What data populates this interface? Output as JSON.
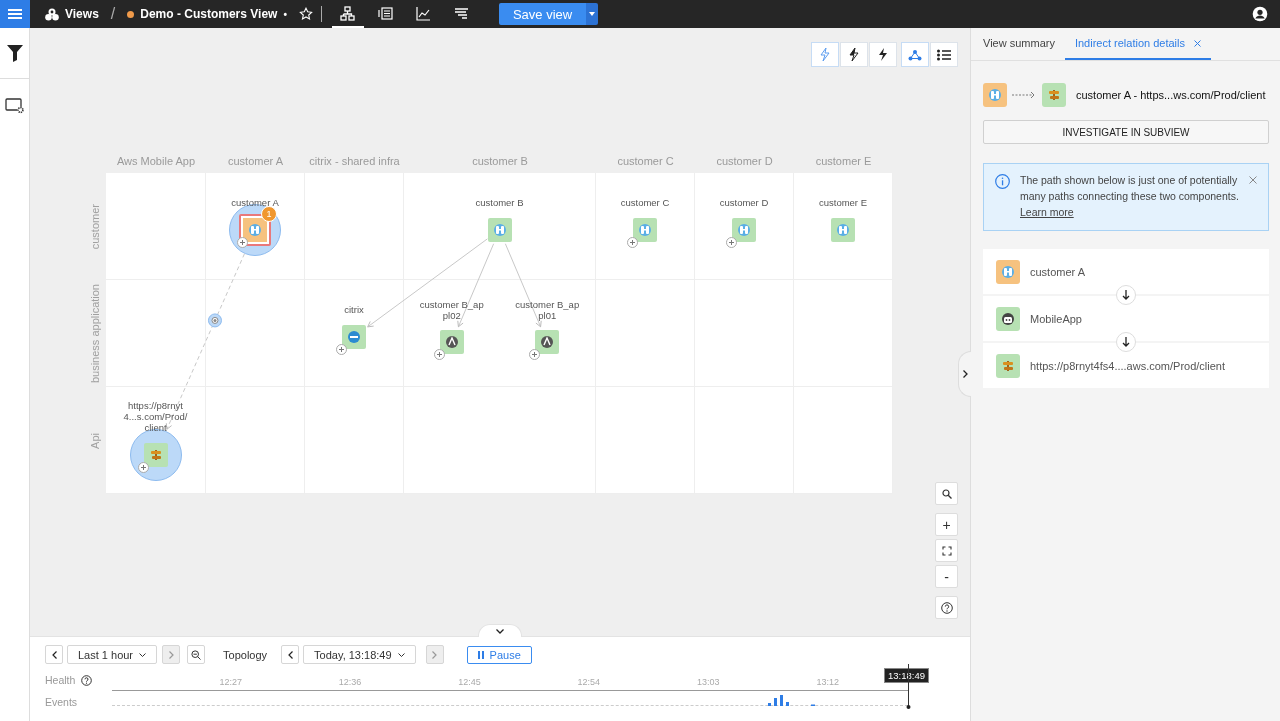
{
  "topbar": {
    "root": "Views",
    "separator": "/",
    "view_name": "Demo - Customers View",
    "unsaved_mark": "•",
    "view_modes": [
      {
        "kind": "topology",
        "selected": true
      },
      {
        "kind": "list",
        "selected": false
      },
      {
        "kind": "chart",
        "selected": false
      },
      {
        "kind": "events",
        "selected": false
      }
    ],
    "save_button": "Save view"
  },
  "canvas_toolbar": {
    "severity_filters": [
      {
        "kind": "outline",
        "selected": true
      },
      {
        "kind": "half",
        "selected": false
      },
      {
        "kind": "solid",
        "selected": false
      }
    ],
    "layouts": [
      {
        "kind": "graph",
        "selected": true
      },
      {
        "kind": "list",
        "selected": false
      }
    ]
  },
  "diagram": {
    "columns": [
      "Aws Mobile App",
      "customer A",
      "citrix - shared infra",
      "customer B",
      "customer C",
      "customer D",
      "customer E"
    ],
    "rows": [
      {
        "label": "customer",
        "cells": [
          {},
          {
            "nodes": [
              {
                "label": "customer A",
                "color": "#f6c27f",
                "kind": "customer",
                "highlighted": true,
                "selected": true,
                "badge": "1",
                "expandable": true,
                "outgoing": true
              }
            ]
          },
          {},
          {
            "nodes": [
              {
                "label": "customer B",
                "color": "#b7e1b3",
                "kind": "customer",
                "highlighted": false,
                "selected": false,
                "expandable": false,
                "outgoing": true
              }
            ]
          },
          {
            "nodes": [
              {
                "label": "customer C",
                "color": "#b7e1b3",
                "kind": "customer",
                "highlighted": false,
                "selected": false,
                "expandable": true,
                "outgoing": false
              }
            ]
          },
          {
            "nodes": [
              {
                "label": "customer D",
                "color": "#b7e1b3",
                "kind": "customer",
                "highlighted": false,
                "selected": false,
                "expandable": true,
                "outgoing": false
              }
            ]
          },
          {
            "nodes": [
              {
                "label": "customer E",
                "color": "#b7e1b3",
                "kind": "customer",
                "highlighted": false,
                "selected": false,
                "expandable": false,
                "outgoing": false
              }
            ]
          }
        ]
      },
      {
        "label": "business application",
        "cells": [
          {},
          {},
          {
            "nodes": [
              {
                "label": "citrix",
                "color": "#b7e1b3",
                "kind": "citrix",
                "highlighted": false,
                "selected": false,
                "expandable": true,
                "outgoing": false,
                "incoming": {
                  "dashed": false,
                  "midpoint": false
                }
              }
            ]
          },
          {
            "nodes": [
              {
                "label": "customer B_appl02",
                "color": "#b7e1b3",
                "kind": "app",
                "highlighted": false,
                "selected": false,
                "expandable": true,
                "outgoing": false,
                "incoming": {
                  "dashed": false,
                  "midpoint": false
                }
              },
              {
                "label": "customer B_appl01",
                "color": "#b7e1b3",
                "kind": "app",
                "highlighted": false,
                "selected": false,
                "expandable": true,
                "outgoing": false,
                "incoming": {
                  "dashed": false,
                  "midpoint": false
                }
              }
            ]
          },
          {},
          {},
          {}
        ]
      },
      {
        "label": "Api",
        "cells": [
          {
            "nodes": [
              {
                "label": "https://p8rnyt4...s.com/Prod/client",
                "color": "#b7e1b3",
                "kind": "api",
                "highlighted": true,
                "selected": false,
                "expandable": true,
                "outgoing": false,
                "incoming": {
                  "dashed": true,
                  "midpoint": true
                }
              }
            ]
          },
          {},
          {},
          {},
          {},
          {},
          {}
        ]
      }
    ]
  },
  "zoom_controls": {
    "zoom_in": "+",
    "zoom_out": "-"
  },
  "timeline": {
    "range": "Last 1 hour",
    "range_nav": [
      {
        "disabled": false
      },
      {
        "disabled": true
      }
    ],
    "mode": "Topology",
    "time": "Today, 13:18:49",
    "time_nav": [
      {
        "disabled": false
      },
      {
        "disabled": true
      }
    ],
    "pause": "Pause",
    "health_label": "Health",
    "events_label": "Events",
    "ticks": [
      "12:27",
      "12:36",
      "12:45",
      "12:54",
      "13:03",
      "13:12"
    ],
    "current_time": "13:18:49"
  },
  "right_panel": {
    "tabs": [
      {
        "label": "View summary",
        "selected": false,
        "closable": false
      },
      {
        "label": "Indirect relation details",
        "selected": true,
        "closable": true
      }
    ],
    "relation": {
      "from": {
        "kind": "customer",
        "color": "#f6c27f"
      },
      "to": {
        "kind": "api",
        "color": "#b7e1b3"
      },
      "title": "customer A - https...ws.com/Prod/client"
    },
    "investigate_button": "INVESTIGATE IN SUBVIEW",
    "info": {
      "text": "The path shown below is just one of potentially many paths connecting these two components.",
      "link": "Learn more"
    },
    "path": [
      {
        "label": "customer A",
        "kind": "customer",
        "color": "#f6c27f"
      },
      {
        "label": "MobileApp",
        "kind": "mobile",
        "color": "#b7e1b3"
      },
      {
        "label": "https://p8rnyt4fs4....aws.com/Prod/client",
        "kind": "api",
        "color": "#b7e1b3"
      }
    ]
  }
}
